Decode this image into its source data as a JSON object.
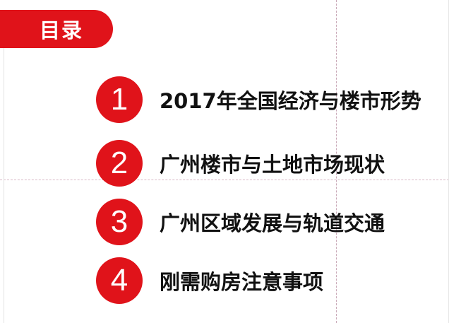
{
  "title": "目录",
  "items": [
    {
      "number": "1",
      "label": "2017年全国经济与楼市形势"
    },
    {
      "number": "2",
      "label": "广州楼市与土地市场现状"
    },
    {
      "number": "3",
      "label": "广州区域发展与轨道交通"
    },
    {
      "number": "4",
      "label": "刚需购房注意事项"
    }
  ],
  "colors": {
    "accent": "#e0131a",
    "text": "#111111",
    "background": "#ffffff"
  }
}
